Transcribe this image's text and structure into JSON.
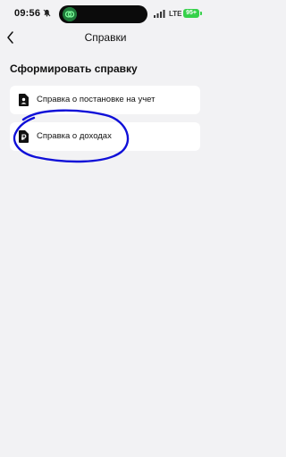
{
  "status_bar": {
    "time": "09:56",
    "network": "LTE",
    "battery": "95+",
    "icons": [
      "bell-muted-icon",
      "app-logo-icon",
      "signal-icon"
    ]
  },
  "nav": {
    "title": "Справки",
    "back_icon": "chevron-left-icon"
  },
  "section": {
    "title": "Сформировать справку"
  },
  "items": [
    {
      "label": "Справка о постановке на учет",
      "icon": "person-document-icon"
    },
    {
      "label": "Справка о доходах",
      "icon": "money-document-icon"
    }
  ],
  "colors": {
    "background": "#f2f2f4",
    "card": "#ffffff",
    "battery": "#36d14a",
    "annotation": "#1010d8"
  }
}
